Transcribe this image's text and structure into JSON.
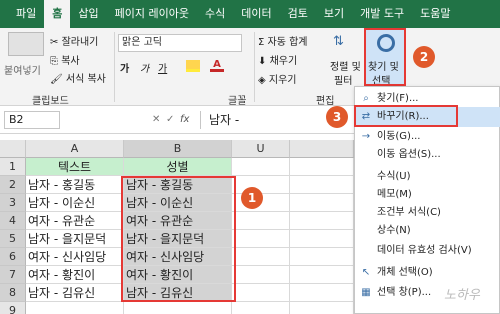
{
  "tabs": [
    "파일",
    "홈",
    "삽입",
    "페이지 레이아웃",
    "수식",
    "데이터",
    "검토",
    "보기",
    "개발 도구",
    "도움말"
  ],
  "ribbon": {
    "clipboard": {
      "paste": "붙여넣기",
      "cut": "잘라내기",
      "copy": "복사",
      "format_copy": "서식 복사",
      "group": "클립보드"
    },
    "font": {
      "name": "맑은 고딕",
      "bold": "가",
      "italic": "가",
      "underline": "가",
      "group": "글꼴"
    },
    "editing": {
      "autosum": "자동 합계",
      "fill": "채우기",
      "clear": "지우기",
      "sort": "정렬 및",
      "sort2": "필터",
      "find": "찾기 및",
      "find2": "선택",
      "group": "편집"
    }
  },
  "formula": {
    "name_box": "B2",
    "fx": "fx",
    "value": "남자 -"
  },
  "columns": [
    "A",
    "B",
    "U"
  ],
  "rows": [
    "1",
    "2",
    "3",
    "4",
    "5",
    "6",
    "7",
    "8",
    "9"
  ],
  "sheet": {
    "col_a": [
      "텍스트",
      "남자 - 홍길동",
      "남자 - 이순신",
      "여자 - 유관순",
      "남자 - 을지문덕",
      "여자 - 신사임당",
      "여자 - 황진이",
      "남자 - 김유신",
      ""
    ],
    "col_b": [
      "성별",
      "남자 - 홍길동",
      "남자 - 이순신",
      "여자 - 유관순",
      "남자 - 을지문덕",
      "여자 - 신사임당",
      "여자 - 황진이",
      "남자 - 김유신",
      ""
    ]
  },
  "menu": [
    "찾기(F)...",
    "바꾸기(R)...",
    "이동(G)...",
    "이동 옵션(S)...",
    "수식(U)",
    "메모(M)",
    "조건부 서식(C)",
    "상수(N)",
    "데이터 유효성 검사(V)",
    "개체 선택(O)",
    "선택 창(P)..."
  ],
  "badges": [
    "1",
    "2",
    "3"
  ],
  "watermark": "노하우",
  "colors": {
    "accent": "#217346",
    "badge": "#e0592b",
    "highlight": "#e53935",
    "header_fill": "#c6efce"
  }
}
